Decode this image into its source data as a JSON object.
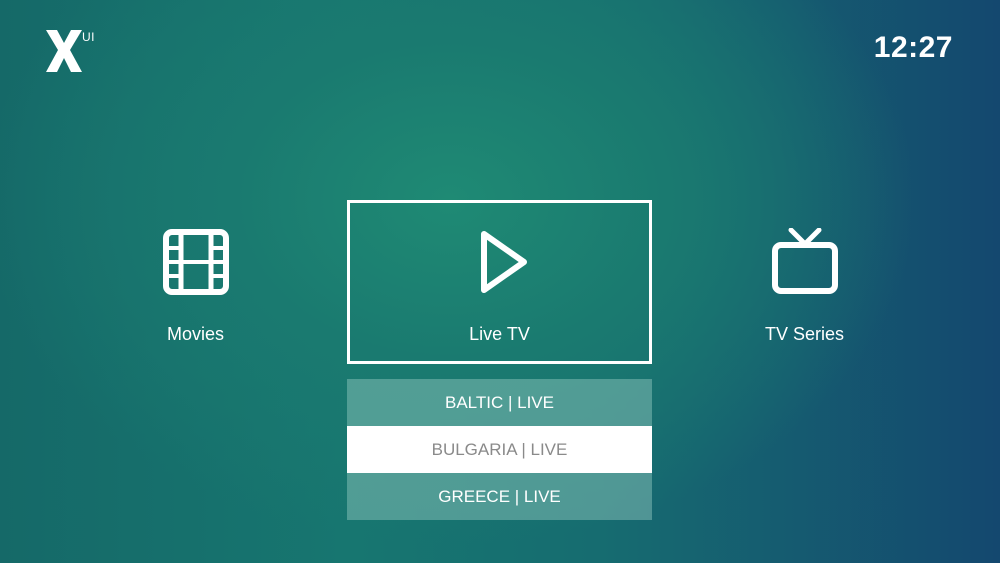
{
  "header": {
    "logo_letter": "X",
    "logo_suffix": "UI",
    "clock": "12:27"
  },
  "tiles": [
    {
      "label": "Movies",
      "icon": "film-icon"
    },
    {
      "label": "Live TV",
      "icon": "play-icon",
      "selected": true
    },
    {
      "label": "TV Series",
      "icon": "tv-icon"
    }
  ],
  "dropdown": {
    "items": [
      {
        "label": "BALTIC | LIVE"
      },
      {
        "label": "BULGARIA | LIVE",
        "selected": true
      },
      {
        "label": "GREECE | LIVE"
      }
    ]
  },
  "colors": {
    "background_start": "#156968",
    "background_end": "#14486f",
    "highlight": "#ffffff",
    "selected_text": "#8a8a8a"
  }
}
